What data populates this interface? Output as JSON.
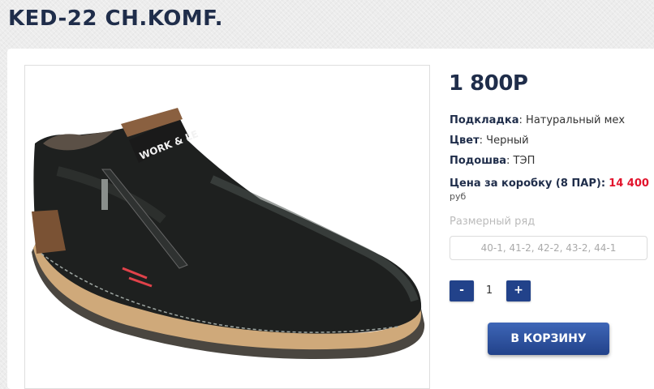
{
  "product": {
    "title": "KED-22 CH.KOMF.",
    "price": "1 800Р",
    "image_logo_text": "WORK & LE",
    "attributes": [
      {
        "name": "Подкладка",
        "value": ": Натуральный мех"
      },
      {
        "name": "Цвет",
        "value": ": Черный"
      },
      {
        "name": "Подошва",
        "value": ": ТЭП"
      }
    ],
    "box_price": {
      "label": "Цена за коробку (8 ПАР):",
      "value": "14 400",
      "unit": "руб"
    },
    "size_label": "Размерный ряд",
    "size_value": "40-1, 41-2, 42-2, 43-2, 44-1"
  },
  "quantity": {
    "minus": "-",
    "value": "1",
    "plus": "+"
  },
  "cart_button": "В КОРЗИНУ",
  "colors": {
    "brand": "#1f2d4a",
    "button": "#22428a",
    "accent": "#e2142d"
  }
}
